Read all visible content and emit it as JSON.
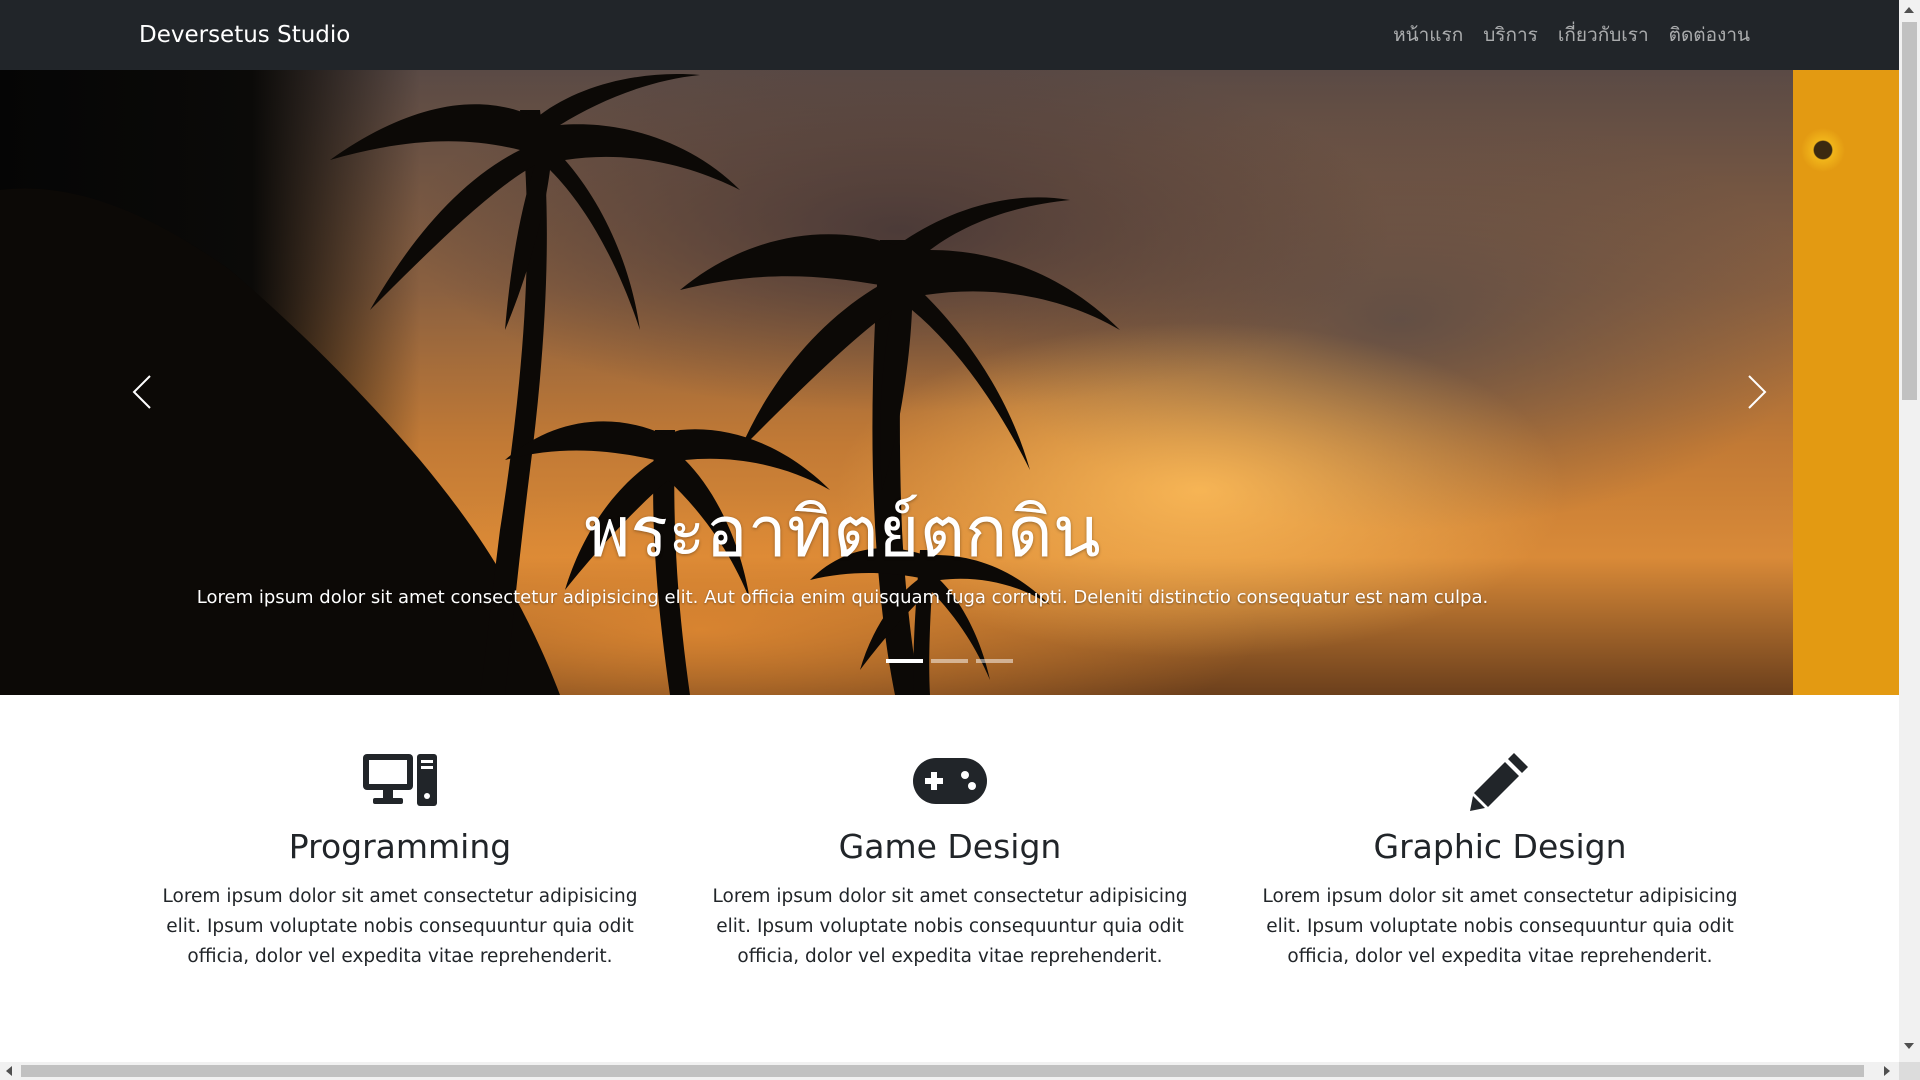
{
  "navbar": {
    "brand": "Deversetus Studio",
    "links": [
      "หน้าแรก",
      "บริการ",
      "เกี่ยวกับเรา",
      "ติดต่องาน"
    ]
  },
  "carousel": {
    "title": "พระอาทิตย์ตกดิน",
    "text": "Lorem ipsum dolor sit amet consectetur adipisicing elit. Aut officia enim quisquam fuga corrupti. Deleniti distinctio consequatur est nam culpa.",
    "prev_icon": "chevron-left-icon",
    "next_icon": "chevron-right-icon",
    "slide_count": 3,
    "active_slide": 1
  },
  "services": [
    {
      "icon": "desktop-computer-icon",
      "title": "Programming",
      "text": "Lorem ipsum dolor sit amet consectetur adipisicing elit. Ipsum voluptate nobis consequuntur quia odit officia, dolor vel expedita vitae reprehenderit."
    },
    {
      "icon": "gamepad-icon",
      "title": "Game Design",
      "text": "Lorem ipsum dolor sit amet consectetur adipisicing elit. Ipsum voluptate nobis consequuntur quia odit officia, dolor vel expedita vitae reprehenderit."
    },
    {
      "icon": "pencil-icon",
      "title": "Graphic Design",
      "text": "Lorem ipsum dolor sit amet consectetur adipisicing elit. Ipsum voluptate nobis consequuntur quia odit officia, dolor vel expedita vitae reprehenderit."
    }
  ],
  "colors": {
    "navbar_bg": "#212529",
    "nav_link": "#9a9da0",
    "text": "#212529",
    "icon": "#212529"
  }
}
